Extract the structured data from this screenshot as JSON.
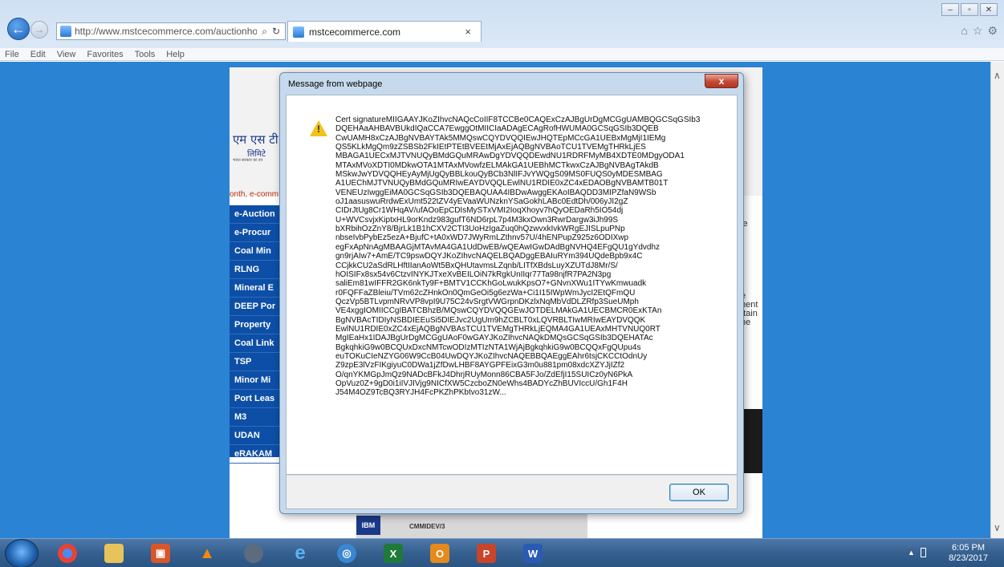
{
  "browser": {
    "address_url": "http://www.mstcecommerce.com/auctionhome/mstc",
    "tab_title": "mstcecommerce.com",
    "menu": [
      "File",
      "Edit",
      "View",
      "Favorites",
      "Tools",
      "Help"
    ]
  },
  "site": {
    "logo_text": "एम एस टी स",
    "logo_sub": "लिमिटे",
    "logo_tag": "भारत सरकार का उप",
    "marquee": "onth, e-comm",
    "menu_items": [
      "e-Auction",
      "e-Procur",
      "Coal Min",
      "RLNG",
      "Mineral E",
      "DEEP Por",
      "Property",
      "Coal Link",
      "TSP",
      "Minor Mi",
      "Port Leas",
      "M3",
      "UDAN",
      "eRAKAM"
    ],
    "right_snippet_1": "se",
    "right_snippet_2": "te\nment\nptain\nthe",
    "banner_ibm": "IBM",
    "banner_cmmi": "CMMIDEV/3"
  },
  "dialog": {
    "title": "Message from webpage",
    "close_label": "x",
    "message": "Cert signatureMIIGAAYJKoZIhvcNAQcCoIIF8TCCBe0CAQExCzAJBgUrDgMCGgUAMBQGCSqGSIb3\nDQEHAaAHBAVBUkdIQaCCA7EwggOtMIICIaADAgECAgRofHWUMA0GCSqGSIb3DQEB\nCwUAMH8xCzAJBgNVBAYTAk5MMQswCQYDVQQIEwJHQTEpMCcGA1UEBxMgMjI1IEMg\nQS5KLkMgQm9zZSBSb2FkIEtPTEtBVEEtMjAxEjAQBgNVBAoTCU1TVEMgTHRkLjES\nMBAGA1UECxMJTVNUQyBMdGQuMRAwDgYDVQQDEwdNU1RDRFMyMB4XDTE0MDgyODA1\nMTAxMVoXDTI0MDkwOTA1MTAxMVowfzELMAkGA1UEBhMCTkwxCzAJBgNVBAgTAkdB\nMSkwJwYDVQQHEyAyMjUgQyBBLkouQyBCb3NlIFJvYWQgS09MS0FUQS0yMDESMBAG\nA1UEChMJTVNUQyBMdGQuMRIwEAYDVQQLEwlNU1RDIE0xZC4xEDAOBgNVBAMTB01T\nVENEUzIwggEiMA0GCSqGSIb3DQEBAQUAA4IBDwAwggEKAoIBAQDD3MIPZfaN9WSb\noJ1aasuswuRrdwExUmt522tZV4yEVaaWUNzknYSaGokhLABc0EdtDh/006yJI2gZ\nCIDrJtUg8Cr1WHqAV/ufAOoEpCDIsMySTxVMI2IoqXhoyv7hQyOEDaRh5IO54dj\nU+WVCsvjxKiptxHL9orKndz983gufT6ND6rpL7p4M3kxOwn3RwrDargw3iJh99S\nbXRbihOzZnY8/BjrLk1B1hCXV2CTI3UoHzIgaZuq0hQzwvxkIvkWRgEJISLpuPNp\nnbseIvbPybEz5ezA+BjufC+tA0xWD7JWyRmLZthnv57U/4hENPupZ925z6ODIXwp\negFxApNnAgMBAAGjMTAvMA4GA1UdDwEB/wQEAwIGwDAdBgNVHQ4EFgQU1gYdvdhz\ngn9rjAIw7+AmE/TC9pswDQYJKoZIhvcNAQELBQADggEBAIuRYm394UQdeBpb9x4C\nCCjkkCU2aSdRLHftIIanAoWt5BxQHUtavmsLZqnb/LITfXBdsLuyXZUTdJ8Mr/S/\nhOISIFx8sx54v6CtzvINYKJTxeXvBEILOiN7kRgkUnIIqr77Ta98njfR7PA2N3pg\nsaliEm81wIFFR2GK6nkTy9F+BMTV1CCKhGoLwukKpsO7+GNvnXWu1ITYwKmwuadk\nr0FQFFaZBleiu/TVm62cZHnkOn0QmGeOi5g6ezWa+Ci1I15IWpWmJycI2EtQFmQU\nQczVp5BTLvpmNRvVP8vpI9U75C24vSrgtVWGrpnDKzlxNqMbVdDLZRfp3SueUMph\nVE4xggIOMIICCgIBATCBhzB/MQswCQYDVQQGEwJOTDELMAkGA1UECBMCR0ExKTAn\nBgNVBAcTIDIyNSBDIEEuSi5DIEJvc2UgUm9hZCBLT0xLQVRBLTIwMRIwEAYDVQQK\nEwlNU1RDIE0xZC4xEjAQBgNVBAsTCU1TVEMgTHRkLjEQMA4GA1UEAxMHTVNUQ0RT\nMgIEaHx1IDAJBgUrDgMCGgUAoF0wGAYJKoZIhvcNAQkDMQsGCSqGSIb3DQEHATAc\nBgkqhkiG9w0BCQUxDxcNMTcwODIzMTIzNTA1WjAjBgkqhkiG9w0BCQQxFgQUpu4s\neuTOKuCIeNZYG06W9CcB04UwDQYJKoZIhvcNAQEBBQAEggEAhr6tsjCKCCtOdnUy\nZ9zpE3lVzFIKgiyuC0DWa1jZfDwLHBF8AYGPFEixG3m0u881pm08xdcXZYJjIZf2\nO/qnYKMGpJmQz9NADcBFkJ4DhrjRUyMonn86CBA5FJo/ZdEfjI15SUICz0yN6PkA\nOpVuz0Z+9gD0i1iIVJIVjg9NICfXW5CzcboZN0eWhs4BADYcZhBUVIccU/Gh1F4H\nJ54M4OZ9TcBQ3RYJH4FcPKZhPKbtvo31zW...",
    "ok_label": "OK"
  },
  "taskbar": {
    "clock_time": "6:05 PM",
    "clock_date": "8/23/2017",
    "apps": [
      "chrome-icon",
      "file-explorer-icon",
      "app-icon",
      "vlc-icon",
      "app-icon",
      "internet-explorer-icon",
      "app-icon",
      "excel-icon",
      "outlook-icon",
      "powerpoint-icon",
      "word-icon"
    ]
  }
}
